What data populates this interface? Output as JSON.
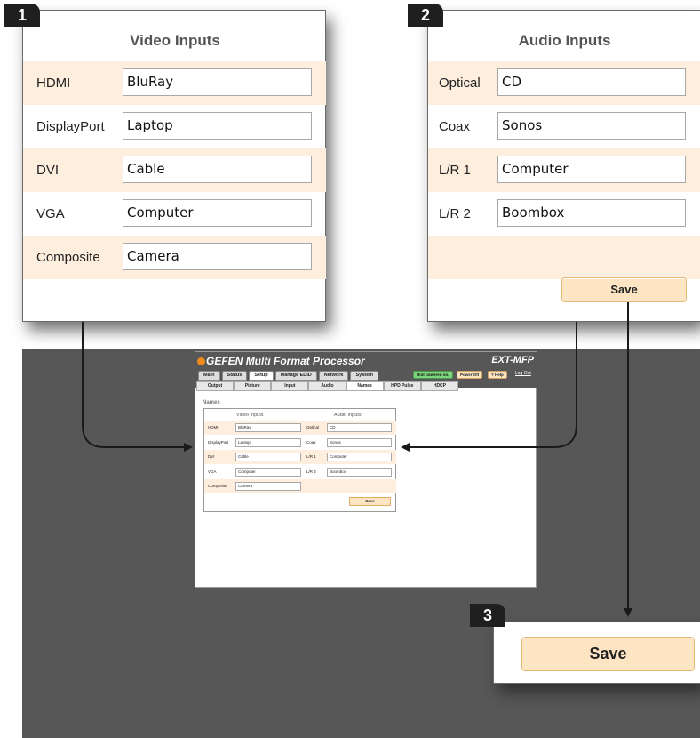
{
  "callouts": {
    "video": "1",
    "audio": "2",
    "save": "3"
  },
  "video_panel": {
    "title": "Video Inputs",
    "rows": [
      {
        "label": "HDMI",
        "value": "BluRay"
      },
      {
        "label": "DisplayPort",
        "value": "Laptop"
      },
      {
        "label": "DVI",
        "value": "Cable"
      },
      {
        "label": "VGA",
        "value": "Computer"
      },
      {
        "label": "Composite",
        "value": "Camera"
      }
    ]
  },
  "audio_panel": {
    "title": "Audio Inputs",
    "rows": [
      {
        "label": "Optical",
        "value": "CD"
      },
      {
        "label": "Coax",
        "value": "Sonos"
      },
      {
        "label": "L/R 1",
        "value": "Computer"
      },
      {
        "label": "L/R 2",
        "value": "Boombox"
      }
    ],
    "save_label": "Save"
  },
  "app": {
    "brand": "GEFEN",
    "title": "Multi Format Processor",
    "model": "EXT-MFP",
    "main_tabs": [
      "Main",
      "Status",
      "Setup",
      "Manage EDID",
      "Network",
      "System"
    ],
    "status_pill": "Unit powered on.",
    "power_button": "Power Off",
    "help_button": "? Help",
    "logout_link": "Log Out",
    "sub_tabs": [
      "Output",
      "Picture",
      "Input",
      "Audio",
      "Names",
      "HPD Pulse",
      "HDCP"
    ],
    "section_heading": "Names",
    "video_title": "Video Inputs",
    "audio_title": "Audio Inputs",
    "save_label": "Save"
  },
  "save_zoom": {
    "label": "Save"
  },
  "colors": {
    "accent": "#fde5c4",
    "row_shade": "#fdeede",
    "backdrop": "#575757",
    "status_green": "#7fd47f"
  }
}
